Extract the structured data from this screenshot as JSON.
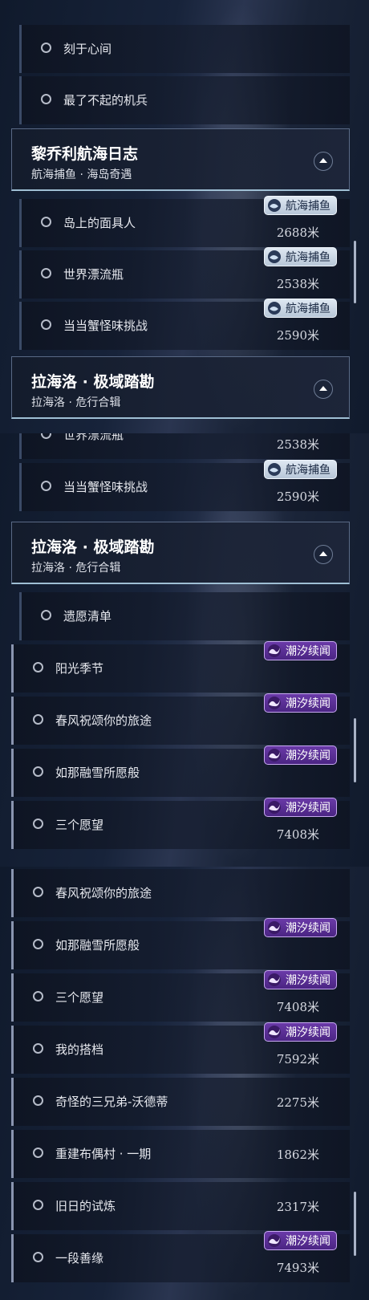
{
  "badge_labels": {
    "fish": "航海捕鱼",
    "tide": "潮汐续闻"
  },
  "icons": {
    "expand": "chevron-up-icon",
    "radio": "radio-circle-icon",
    "fish_badge": "fish-icon",
    "tide_badge": "wave-icon"
  },
  "colors": {
    "fish_badge": "#c9d6e6",
    "tide_badge": "#5a2d96"
  },
  "panel1": {
    "items": [
      {
        "label": "刻于心间"
      },
      {
        "label": "最了不起的机兵"
      }
    ],
    "header_a": {
      "title": "黎乔利航海日志",
      "subtitle": "航海捕鱼 · 海岛奇遇"
    },
    "items_b": [
      {
        "label": "岛上的面具人",
        "distance": "2688米"
      },
      {
        "label": "世界漂流瓶",
        "distance": "2538米"
      },
      {
        "label": "当当蟹怪味挑战",
        "distance": "2590米"
      }
    ],
    "header_b": {
      "title": "拉海洛 · 极域踏勘",
      "subtitle": "拉海洛 · 危行合辑"
    }
  },
  "panel2": {
    "partial_top": {
      "label": "世界漂流瓶",
      "distance": "2538米"
    },
    "items_a": [
      {
        "label": "当当蟹怪味挑战",
        "distance": "2590米"
      }
    ],
    "header": {
      "title": "拉海洛 · 极域踏勘",
      "subtitle": "拉海洛 · 危行合辑"
    },
    "items_b": [
      {
        "label": "遗愿清单"
      },
      {
        "label": "阳光季节"
      },
      {
        "label": "春风祝颂你的旅途"
      },
      {
        "label": "如那融雪所愿般"
      },
      {
        "label": "三个愿望",
        "distance": "7408米"
      }
    ]
  },
  "panel3": {
    "items": [
      {
        "label": "春风祝颂你的旅途"
      },
      {
        "label": "如那融雪所愿般"
      },
      {
        "label": "三个愿望",
        "distance": "7408米"
      },
      {
        "label": "我的搭档",
        "distance": "7592米"
      },
      {
        "label": "奇怪的三兄弟-沃德蒂",
        "distance": "2275米"
      },
      {
        "label": "重建布偶村 · 一期",
        "distance": "1862米"
      },
      {
        "label": "旧日的试炼",
        "distance": "2317米"
      },
      {
        "label": "一段善缘",
        "distance": "7493米"
      }
    ]
  }
}
